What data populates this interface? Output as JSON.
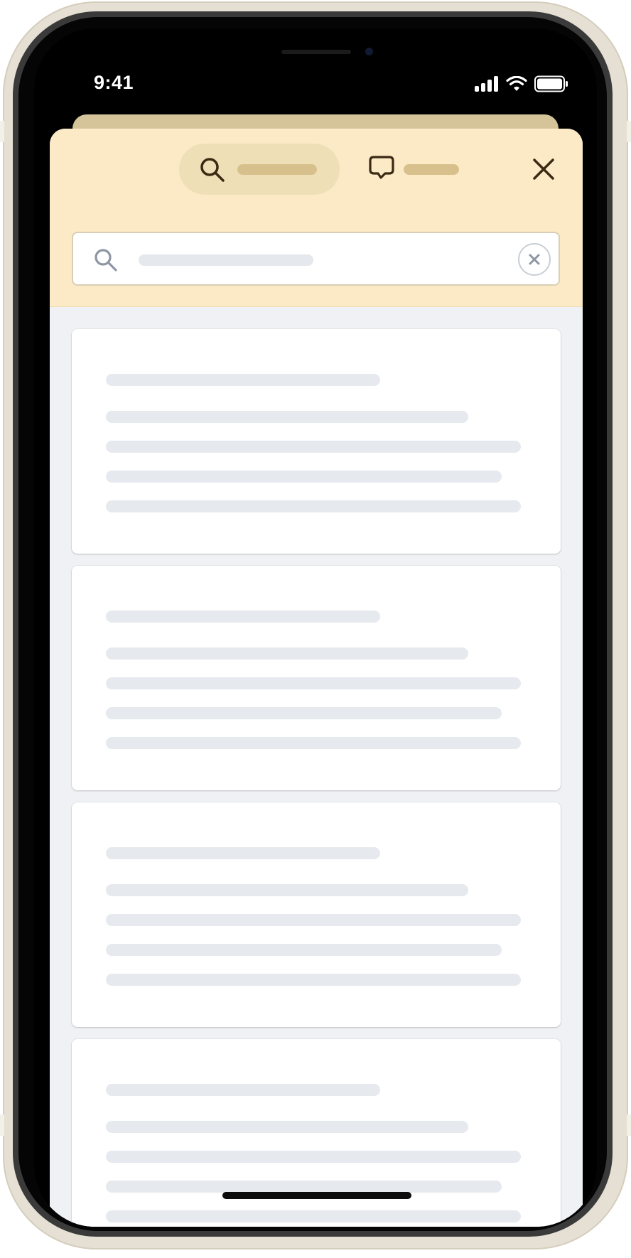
{
  "status_bar": {
    "time": "9:41",
    "icons": [
      "cellular-signal-icon",
      "wifi-icon",
      "battery-icon"
    ]
  },
  "sheet": {
    "tabs": [
      {
        "icon": "search-icon",
        "label": "",
        "selected": true
      },
      {
        "icon": "chat-bubble-icon",
        "label": "",
        "selected": false
      }
    ],
    "close_icon": "close-icon",
    "search": {
      "value": "",
      "placeholder": "",
      "search_icon": "search-icon",
      "clear_icon": "clear-x-icon"
    },
    "results": [
      {
        "state": "loading"
      },
      {
        "state": "loading"
      },
      {
        "state": "loading"
      },
      {
        "state": "loading"
      }
    ]
  },
  "colors": {
    "header_background": "#fceac7",
    "selected_tab_background": "#eedfb6",
    "placeholder_bar": "#d7c08c",
    "skeleton_bar": "#e6e9ed",
    "list_background": "#eff1f4",
    "icon_dark": "#3a2a14"
  }
}
